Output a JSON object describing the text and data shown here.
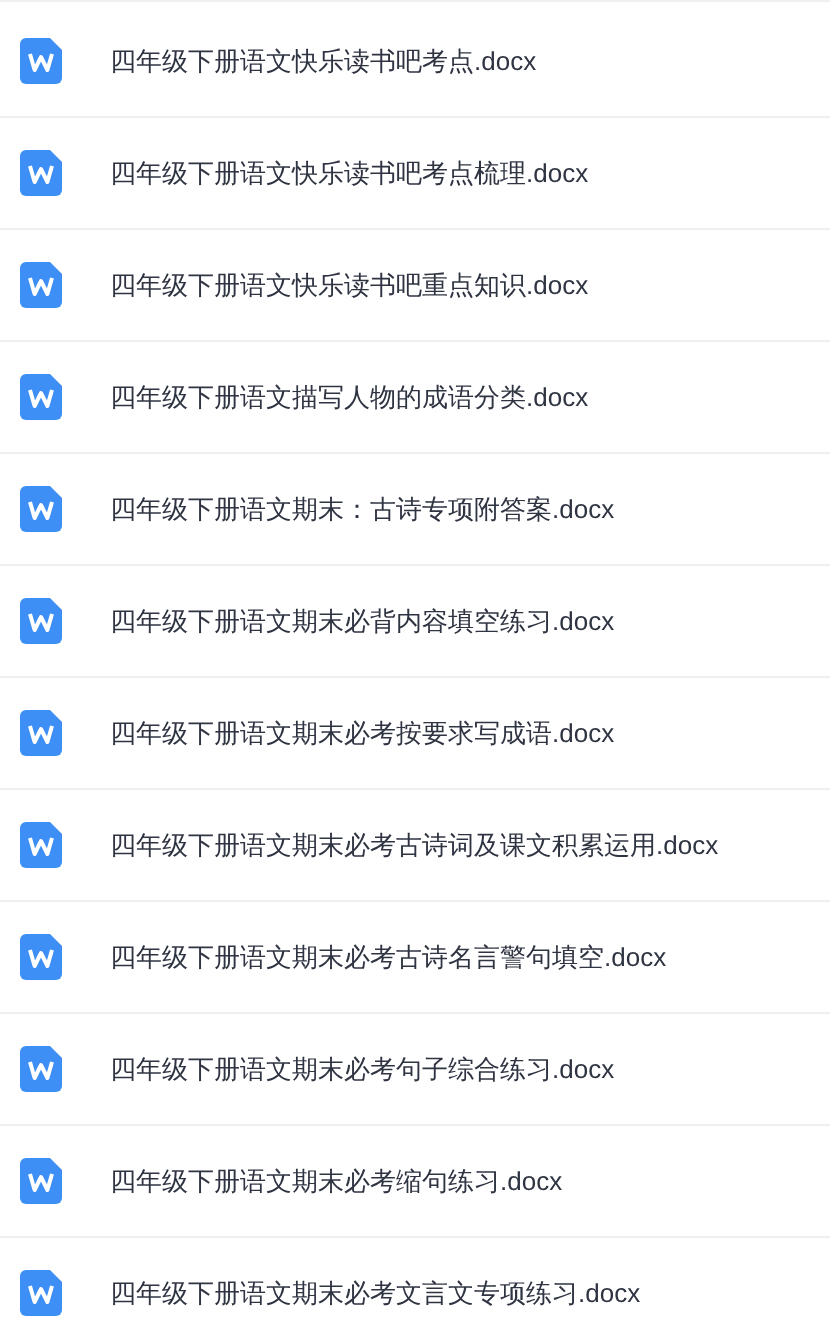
{
  "files": [
    {
      "name": "四年级下册语文快乐读书吧考点.docx"
    },
    {
      "name": "四年级下册语文快乐读书吧考点梳理.docx"
    },
    {
      "name": "四年级下册语文快乐读书吧重点知识.docx"
    },
    {
      "name": "四年级下册语文描写人物的成语分类.docx"
    },
    {
      "name": "四年级下册语文期末：古诗专项附答案.docx"
    },
    {
      "name": "四年级下册语文期末必背内容填空练习.docx"
    },
    {
      "name": "四年级下册语文期末必考按要求写成语.docx"
    },
    {
      "name": "四年级下册语文期末必考古诗词及课文积累运用.docx"
    },
    {
      "name": "四年级下册语文期末必考古诗名言警句填空.docx"
    },
    {
      "name": "四年级下册语文期末必考句子综合练习.docx"
    },
    {
      "name": "四年级下册语文期末必考缩句练习.docx"
    },
    {
      "name": "四年级下册语文期末必考文言文专项练习.docx"
    }
  ]
}
